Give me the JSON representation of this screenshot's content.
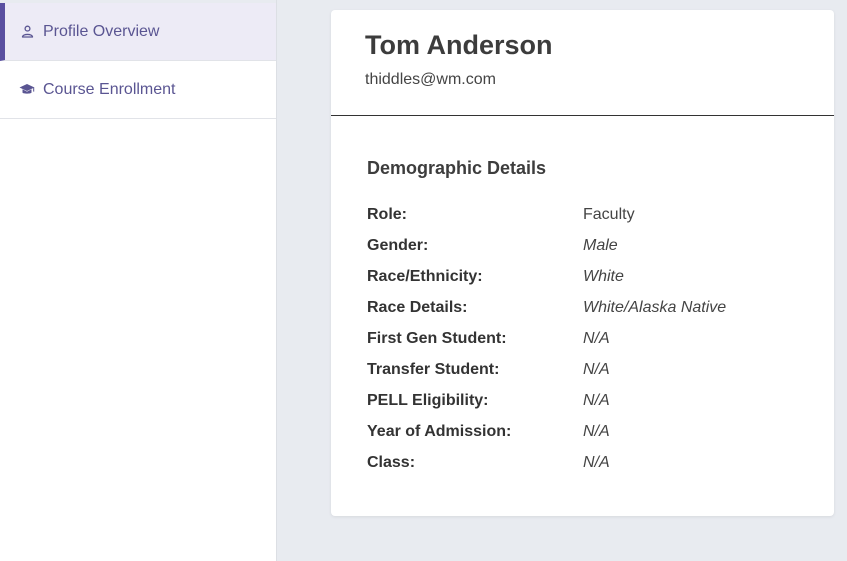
{
  "sidebar": {
    "items": [
      {
        "label": "Profile Overview",
        "icon": "user-icon",
        "active": true
      },
      {
        "label": "Course Enrollment",
        "icon": "graduation-cap-icon",
        "active": false
      }
    ]
  },
  "profile": {
    "name": "Tom Anderson",
    "email": "thiddles@wm.com"
  },
  "demographics": {
    "title": "Demographic Details",
    "rows": [
      {
        "label": "Role:",
        "value": "Faculty"
      },
      {
        "label": "Gender:",
        "value": "Male"
      },
      {
        "label": "Race/Ethnicity:",
        "value": "White"
      },
      {
        "label": "Race Details:",
        "value": "White/Alaska Native"
      },
      {
        "label": "First Gen Student:",
        "value": "N/A"
      },
      {
        "label": "Transfer Student:",
        "value": "N/A"
      },
      {
        "label": "PELL Eligibility:",
        "value": "N/A"
      },
      {
        "label": "Year of Admission:",
        "value": "N/A"
      },
      {
        "label": "Class:",
        "value": "N/A"
      }
    ]
  },
  "colors": {
    "accent": "#5a4fa0",
    "nav_text": "#5a5592",
    "active_bg": "#edebf6",
    "page_bg": "#e8ebf0"
  }
}
